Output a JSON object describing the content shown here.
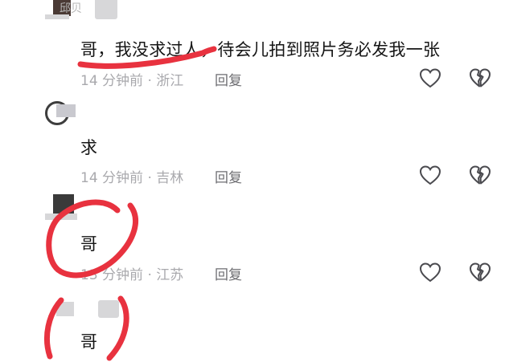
{
  "comments": [
    {
      "username": "邱贝",
      "text": "哥，我没求过人，待会儿拍到照片务必发我一张",
      "meta": "14 分钟前 · 浙江",
      "reply_label": "回复"
    },
    {
      "text": "求",
      "meta": "14 分钟前 · 吉林",
      "reply_label": "回复"
    },
    {
      "text": "哥",
      "meta": "13 分钟前 · 江苏",
      "reply_label": "回复"
    },
    {
      "text": "哥"
    }
  ],
  "colors": {
    "annotation": "#e8323f",
    "text": "#161616",
    "meta": "#a9a9ad"
  },
  "icons": {
    "like": "heart-outline-icon",
    "dislike": "broken-heart-outline-icon"
  }
}
